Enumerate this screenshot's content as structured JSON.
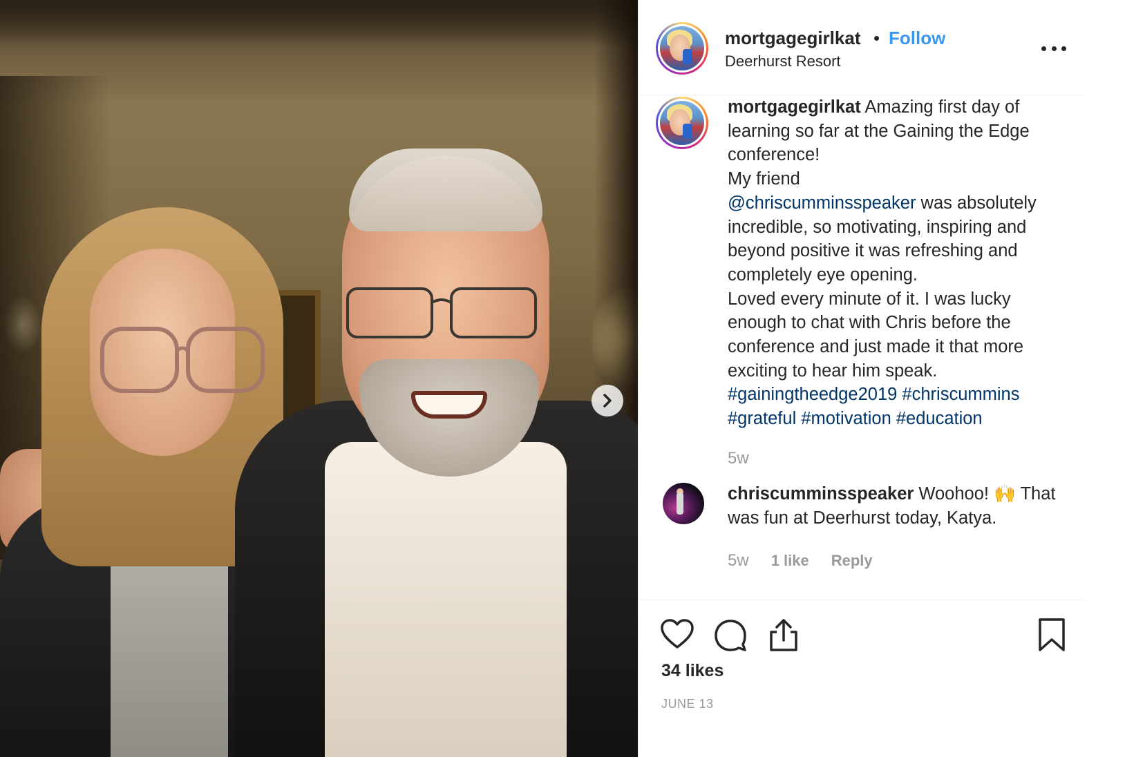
{
  "post": {
    "username": "mortgagegirlkat",
    "separator": "•",
    "follow_label": "Follow",
    "location": "Deerhurst Resort",
    "more_icon": "more-options-icon"
  },
  "caption": {
    "username": "mortgagegirlkat",
    "text_1": " Amazing first day of learning so far at the Gaining the Edge conference!",
    "text_2": "My friend",
    "mention": "@chriscumminsspeaker",
    "text_3": " was absolutely incredible, so motivating, inspiring and beyond positive it was refreshing and completely eye opening.",
    "text_4": "Loved every minute of it. I was lucky enough to chat with Chris before the conference and just made it that more exciting to hear him speak.",
    "hashtags": [
      "#gainingtheedge2019",
      "#chriscummins",
      "#grateful",
      "#motivation",
      "#education"
    ],
    "time": "5w"
  },
  "comment": {
    "username": "chriscumminsspeaker",
    "text": " Woohoo! 🙌 That was fun at Deerhurst today, Katya.",
    "time": "5w",
    "likes": "1 like",
    "reply_label": "Reply"
  },
  "actions": {
    "like_icon": "heart-icon",
    "comment_icon": "comment-icon",
    "share_icon": "share-icon",
    "save_icon": "bookmark-icon",
    "likes_count": "34 likes",
    "date": "JUNE 13"
  },
  "carousel": {
    "next_icon": "chevron-right-icon"
  },
  "colors": {
    "link": "#003569",
    "follow": "#3897f0",
    "muted": "#999999",
    "text": "#262626"
  }
}
